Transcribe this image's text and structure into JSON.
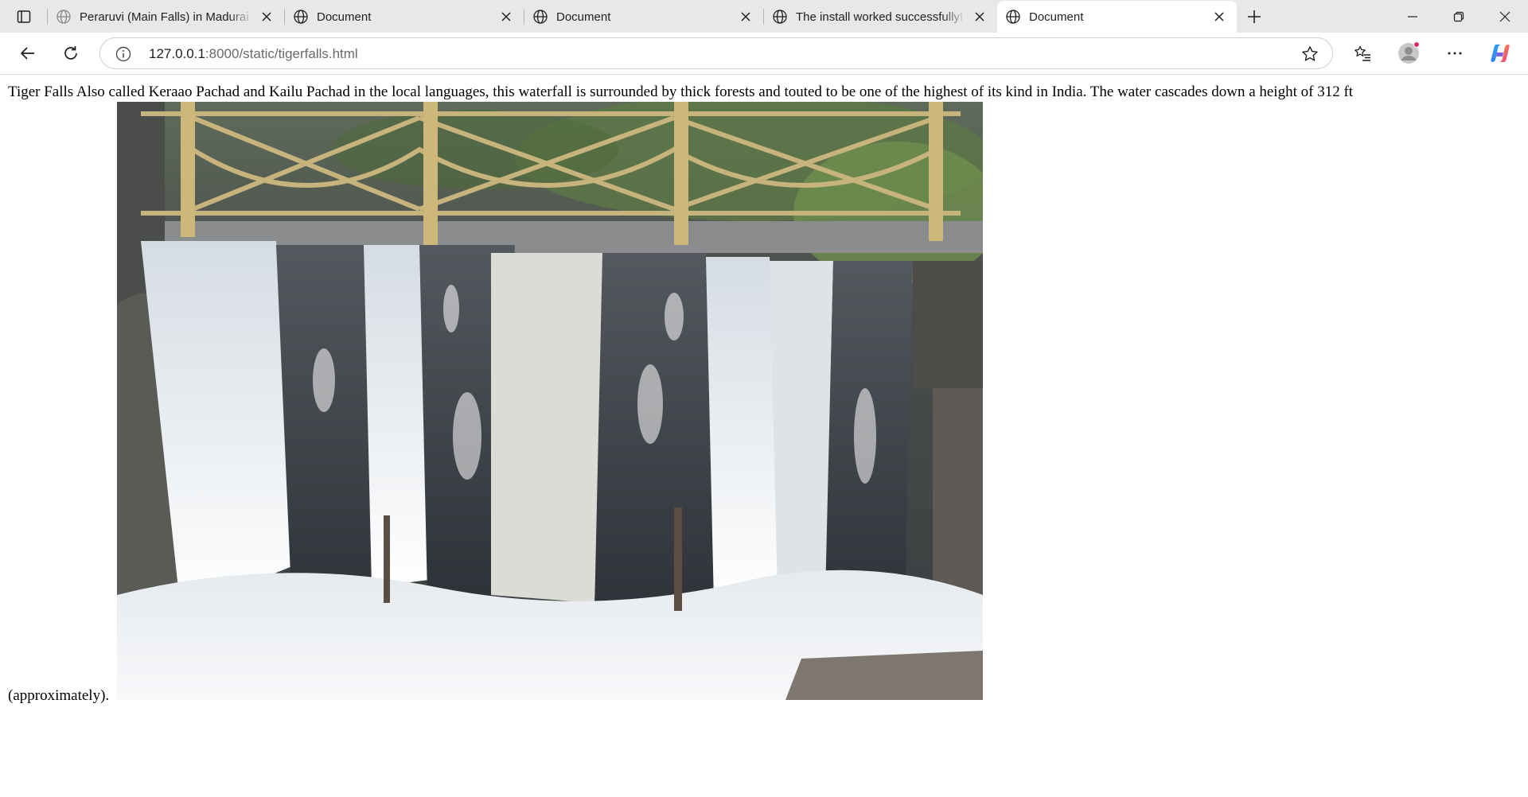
{
  "browser": {
    "tabs": [
      {
        "title": "Peraruvi (Main Falls) in Madurai | Madurai",
        "active": false
      },
      {
        "title": "Document",
        "active": false
      },
      {
        "title": "Document",
        "active": false
      },
      {
        "title": "The install worked successfully! Congratulations!",
        "active": false
      },
      {
        "title": "Document",
        "active": true
      }
    ],
    "url_host": "127.0.0.1",
    "url_path": ":8000/static/tigerfalls.html"
  },
  "page": {
    "text_before": "Tiger Falls Also called Keraao Pachad and Kailu Pachad in the local languages, this waterfall is surrounded by thick forests and touted to be one of the highest of its kind in India. The water cascades down a height of 312 ft",
    "text_after": "(approximately)."
  },
  "colors": {
    "tabstrip_bg": "#e8e8e8",
    "active_tab_bg": "#ffffff",
    "icon_color": "#1f1f1f",
    "notification_dot": "#e0245e"
  }
}
